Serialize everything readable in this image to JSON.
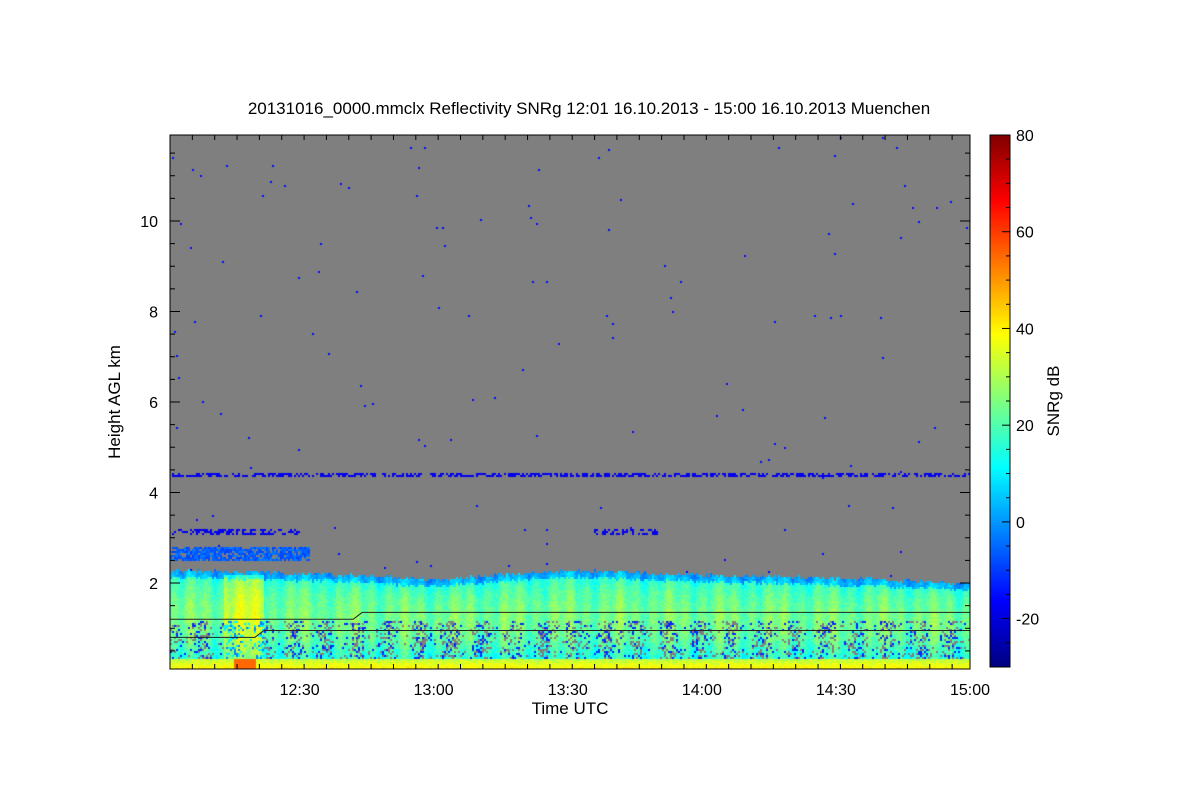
{
  "chart_data": {
    "type": "heatmap",
    "title": "20131016_0000.mmclx Reflectivity SNRg   12:01 16.10.2013 - 15:00 16.10.2013 Muenchen",
    "xlabel": "Time UTC",
    "ylabel": "Height AGL km",
    "colorbar_label": "SNRg dB",
    "x_range_minutes_utc": [
      721,
      900
    ],
    "y_range_km": [
      0.1,
      11.9
    ],
    "color_range_db": [
      -30,
      80
    ],
    "x_ticks": [
      {
        "minute": 750,
        "label": "12:30"
      },
      {
        "minute": 780,
        "label": "13:00"
      },
      {
        "minute": 810,
        "label": "13:30"
      },
      {
        "minute": 840,
        "label": "14:00"
      },
      {
        "minute": 870,
        "label": "14:30"
      },
      {
        "minute": 900,
        "label": "15:00"
      }
    ],
    "y_ticks": [
      {
        "value": 2,
        "label": "2"
      },
      {
        "value": 4,
        "label": "4"
      },
      {
        "value": 6,
        "label": "6"
      },
      {
        "value": 8,
        "label": "8"
      },
      {
        "value": 10,
        "label": "10"
      }
    ],
    "colorbar_ticks": [
      {
        "value": -20,
        "label": "-20"
      },
      {
        "value": 0,
        "label": "0"
      },
      {
        "value": 20,
        "label": "20"
      },
      {
        "value": 40,
        "label": "40"
      },
      {
        "value": 60,
        "label": "60"
      },
      {
        "value": 80,
        "label": "80"
      }
    ],
    "colormap": [
      "#00007f",
      "#0000ff",
      "#007fff",
      "#00ffff",
      "#7fff7f",
      "#ffff00",
      "#ff7f00",
      "#ff0000",
      "#7f0000"
    ],
    "no_signal_color": "#7f7f7f",
    "layers": {
      "cloud_base_km": 0.3,
      "cloud_top_km": [
        {
          "minute": 721,
          "km": 2.3
        },
        {
          "minute": 760,
          "km": 2.2
        },
        {
          "minute": 780,
          "km": 2.1
        },
        {
          "minute": 810,
          "km": 2.3
        },
        {
          "minute": 840,
          "km": 2.2
        },
        {
          "minute": 880,
          "km": 2.1
        },
        {
          "minute": 900,
          "km": 2.0
        }
      ],
      "upper_layer_km": [
        2.5,
        2.8
      ],
      "bands_km": [
        4.4,
        3.15
      ],
      "surface_band_km": [
        0.1,
        0.35
      ],
      "peak_snr_db": 55
    }
  }
}
